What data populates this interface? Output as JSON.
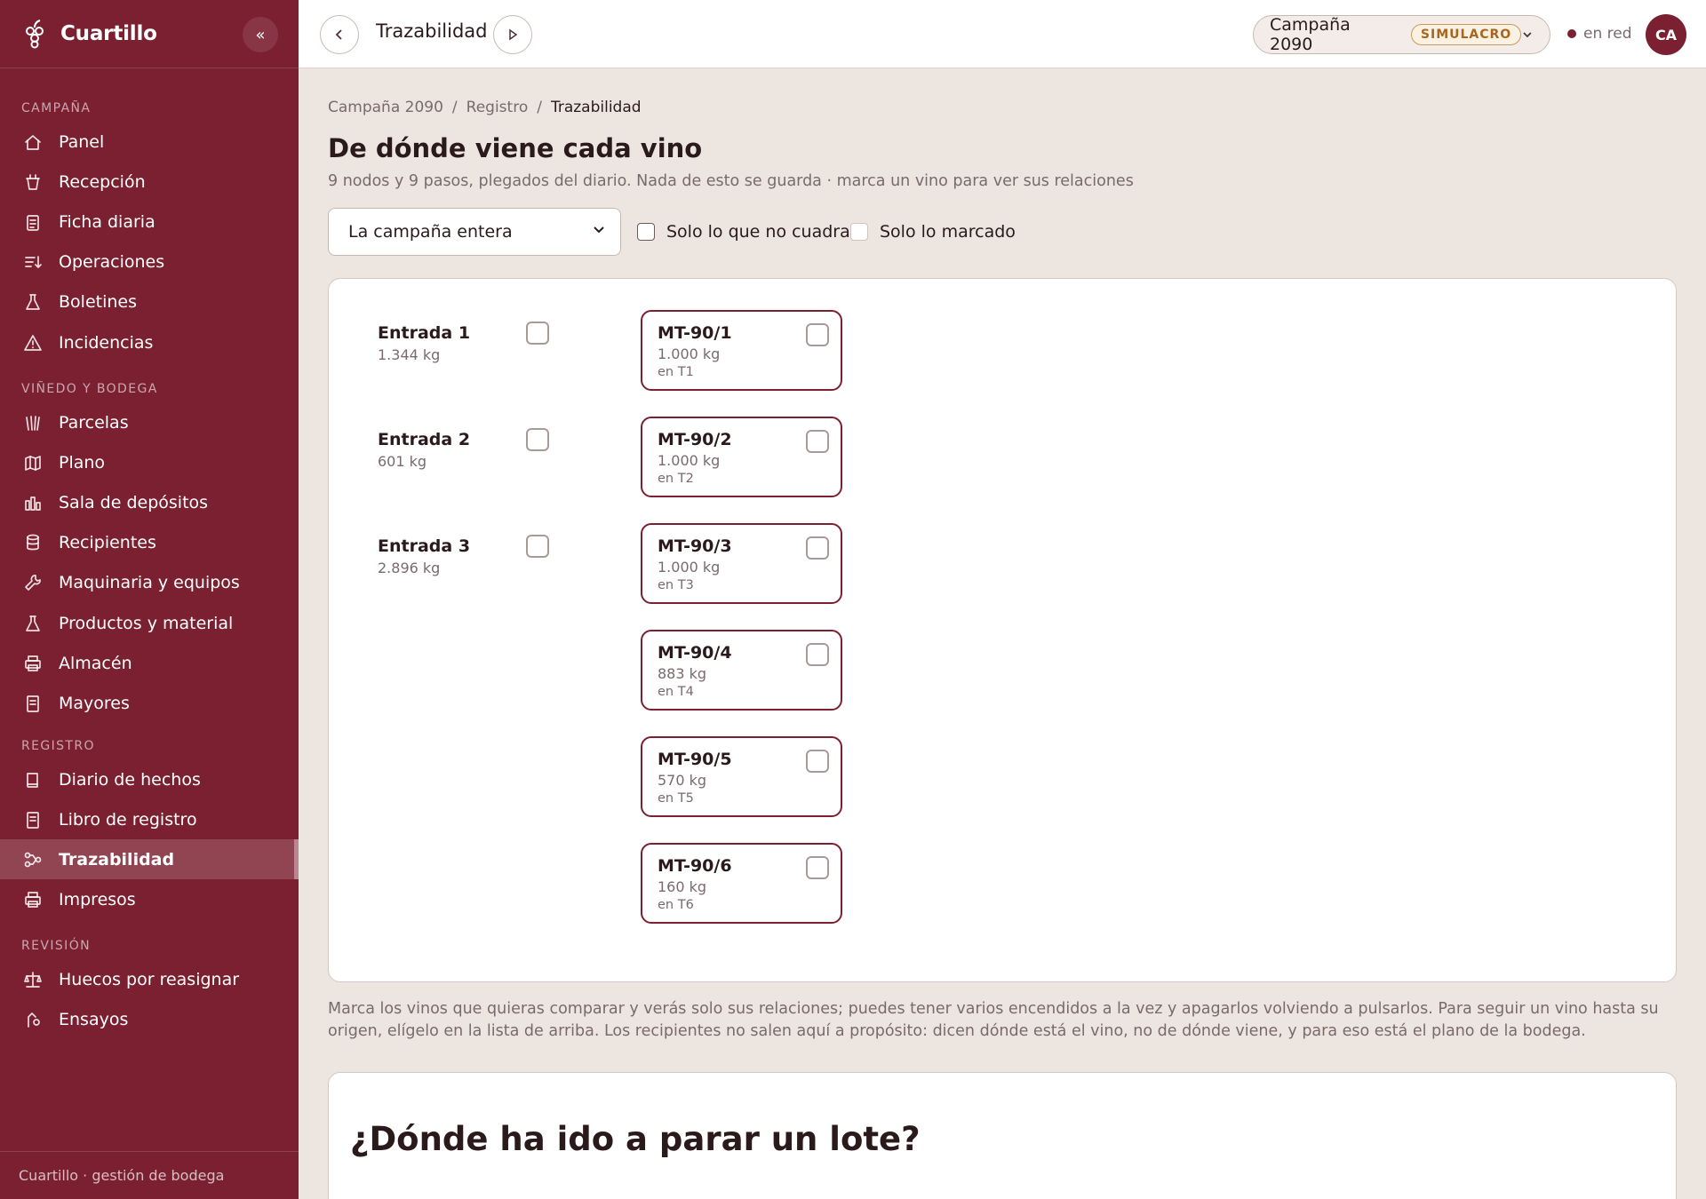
{
  "app": {
    "name": "Cuartillo",
    "footer": "Cuartillo · gestión de bodega"
  },
  "sidebar": {
    "sections": [
      {
        "title": "CAMPAÑA",
        "items": [
          "Panel",
          "Recepción",
          "Ficha diaria",
          "Operaciones",
          "Boletines",
          "Incidencias"
        ]
      },
      {
        "title": "VIÑEDO Y BODEGA",
        "items": [
          "Parcelas",
          "Plano",
          "Sala de depósitos",
          "Recipientes",
          "Maquinaria y equipos",
          "Productos y material",
          "Almacén",
          "Mayores"
        ]
      },
      {
        "title": "REGISTRO",
        "items": [
          "Diario de hechos",
          "Libro de registro",
          "Trazabilidad",
          "Impresos"
        ]
      },
      {
        "title": "REVISIÓN",
        "items": [
          "Huecos por reasignar",
          "Ensayos"
        ]
      }
    ],
    "active": "Trazabilidad"
  },
  "header": {
    "title": "Trazabilidad",
    "campaign": "Campaña 2090",
    "badge": "SIMULACRO",
    "status": "en red",
    "avatar": "CA"
  },
  "breadcrumb": [
    "Campaña 2090",
    "Registro",
    "Trazabilidad"
  ],
  "page": {
    "title": "De dónde viene cada vino",
    "subtitle": "9 nodos y 9 pasos, plegados del diario. Nada de esto se guarda · marca un vino para ver sus relaciones"
  },
  "filters": {
    "scope": "La campaña entera",
    "only_mismatch": "Solo lo que no cuadra",
    "only_marked": "Solo lo marcado"
  },
  "entries": [
    {
      "name": "Entrada 1",
      "qty": "1.344 kg"
    },
    {
      "name": "Entrada 2",
      "qty": "601 kg"
    },
    {
      "name": "Entrada 3",
      "qty": "2.896 kg"
    }
  ],
  "lots": [
    {
      "name": "MT-90/1",
      "qty": "1.000 kg",
      "tank": "en T1"
    },
    {
      "name": "MT-90/2",
      "qty": "1.000 kg",
      "tank": "en T2"
    },
    {
      "name": "MT-90/3",
      "qty": "1.000 kg",
      "tank": "en T3"
    },
    {
      "name": "MT-90/4",
      "qty": "883 kg",
      "tank": "en T4"
    },
    {
      "name": "MT-90/5",
      "qty": "570 kg",
      "tank": "en T5"
    },
    {
      "name": "MT-90/6",
      "qty": "160 kg",
      "tank": "en T6"
    }
  ],
  "hint": "Marca los vinos que quieras comparar y verás solo sus relaciones; puedes tener varios encendidos a la vez y apagarlos volviendo a pulsarlos. Para seguir un vino hasta su origen, elígelo en la lista de arriba. Los recipientes no salen aquí a propósito: dicen dónde está el vino, no de dónde viene, y para eso está el plano de la bodega.",
  "second_card": {
    "title": "¿Dónde ha ido a parar un lote?"
  },
  "colors": {
    "brand": "#7b2030",
    "background": "#ede5df",
    "badge": "#a8661e"
  }
}
